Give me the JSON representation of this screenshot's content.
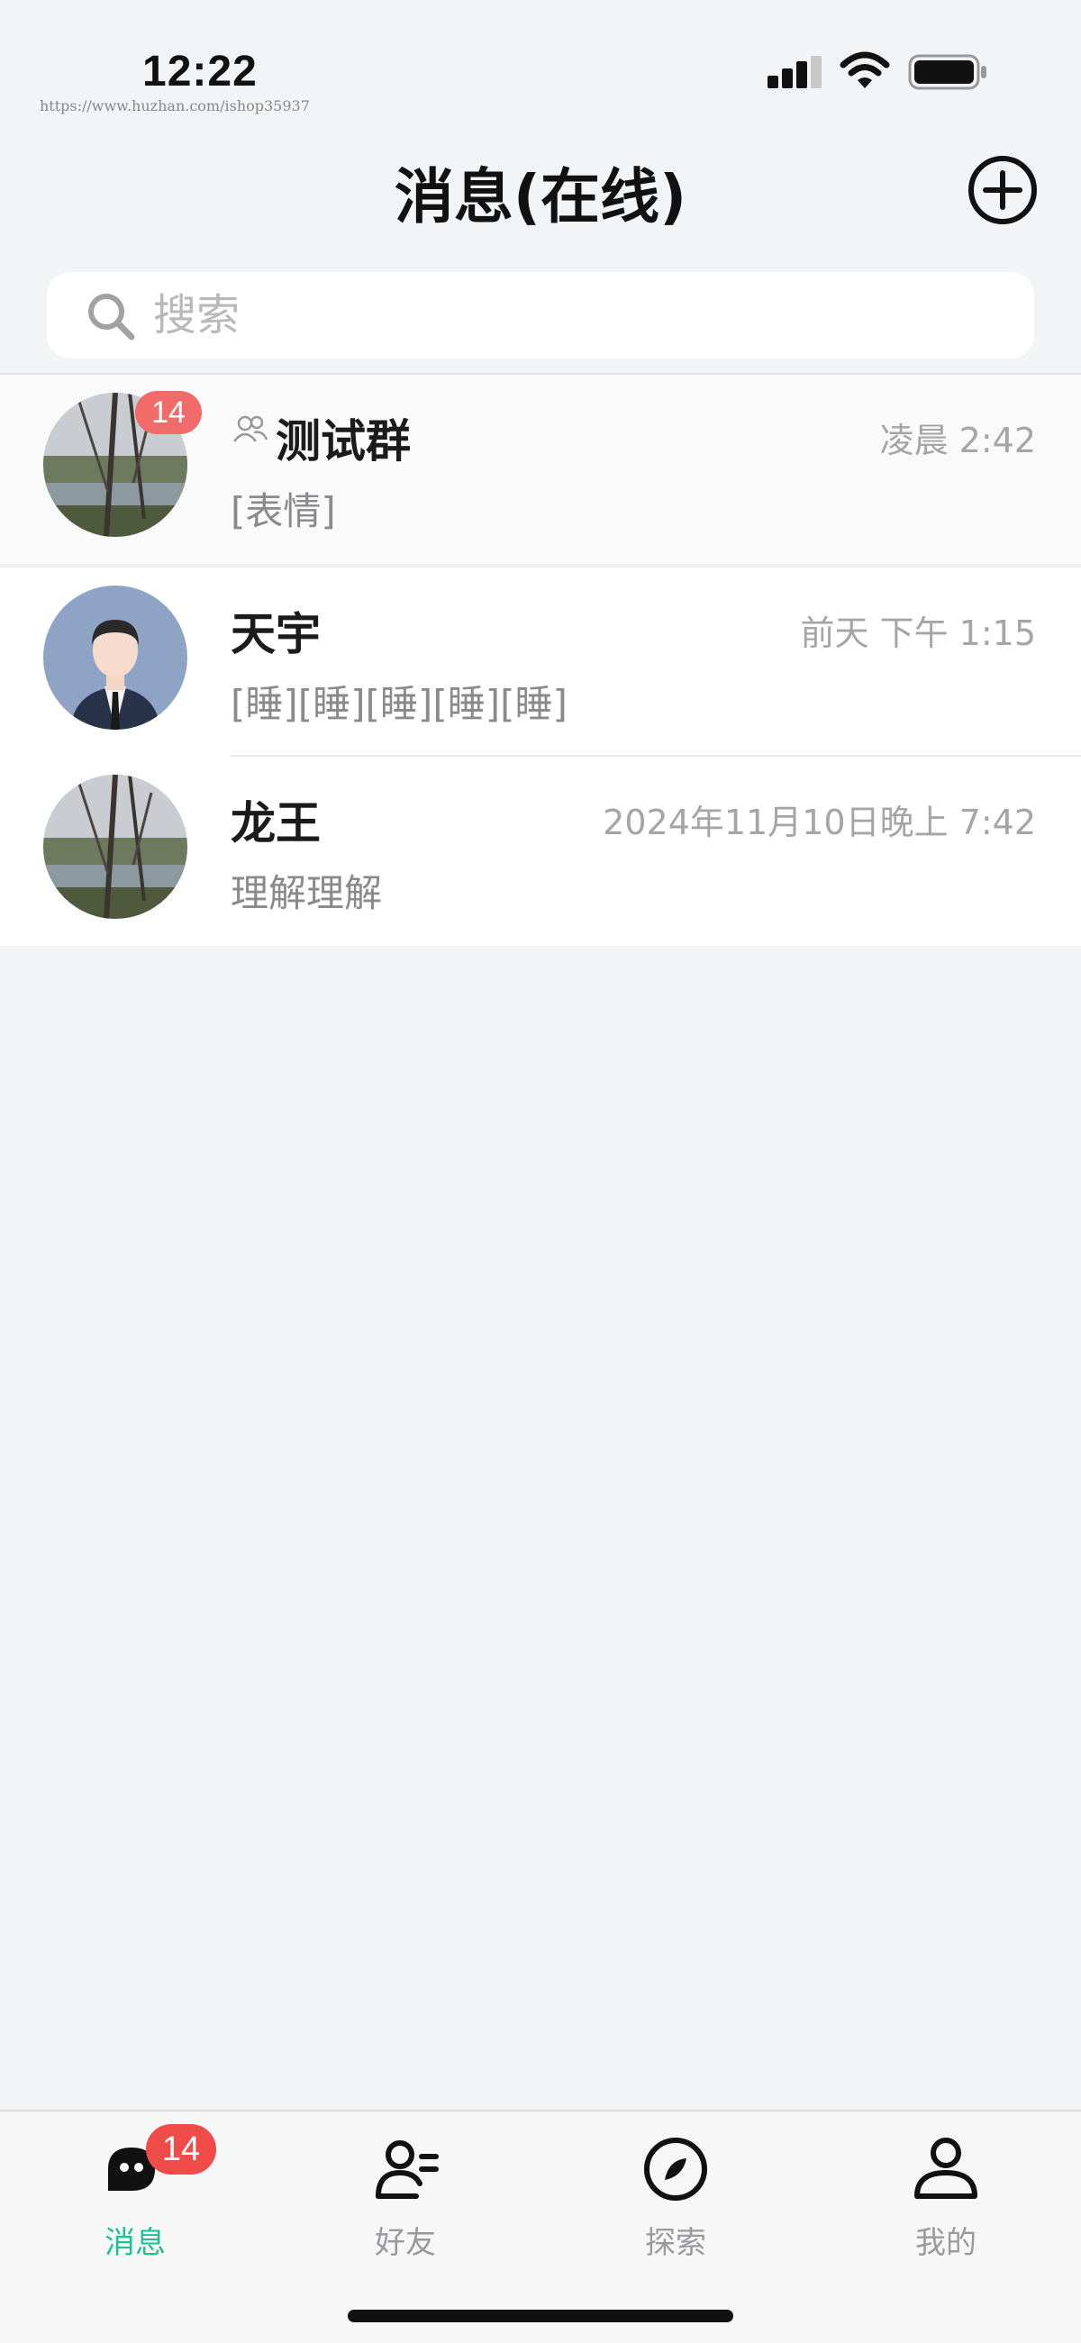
{
  "status_bar": {
    "time": "12:22",
    "watermark": "https://www.huzhan.com/ishop35937"
  },
  "header": {
    "title": "消息(在线)",
    "add_icon": "plus-circle-icon"
  },
  "search": {
    "placeholder": "搜索",
    "value": ""
  },
  "conversations": [
    {
      "name": "测试群",
      "is_group": true,
      "time": "凌晨 2:42",
      "preview": "[表情]",
      "unread": "14",
      "avatar": "landscape-photo"
    },
    {
      "name": "天宇",
      "is_group": false,
      "time": "前天 下午 1:15",
      "preview": "[睡][睡][睡][睡][睡]",
      "unread": "",
      "avatar": "businessman-avatar"
    },
    {
      "name": "龙王",
      "is_group": false,
      "time": "2024年11月10日晚上 7:42",
      "preview": "理解理解",
      "unread": "",
      "avatar": "landscape-photo"
    }
  ],
  "tabbar": {
    "items": [
      {
        "label": "消息",
        "icon": "chat-bubble-icon",
        "active": true,
        "badge": "14"
      },
      {
        "label": "好友",
        "icon": "friends-icon",
        "active": false
      },
      {
        "label": "探索",
        "icon": "compass-icon",
        "active": false
      },
      {
        "label": "我的",
        "icon": "profile-icon",
        "active": false
      }
    ]
  },
  "colors": {
    "accent": "#1dc192",
    "badge": "#f26b6b",
    "background": "#f3f4f6"
  }
}
